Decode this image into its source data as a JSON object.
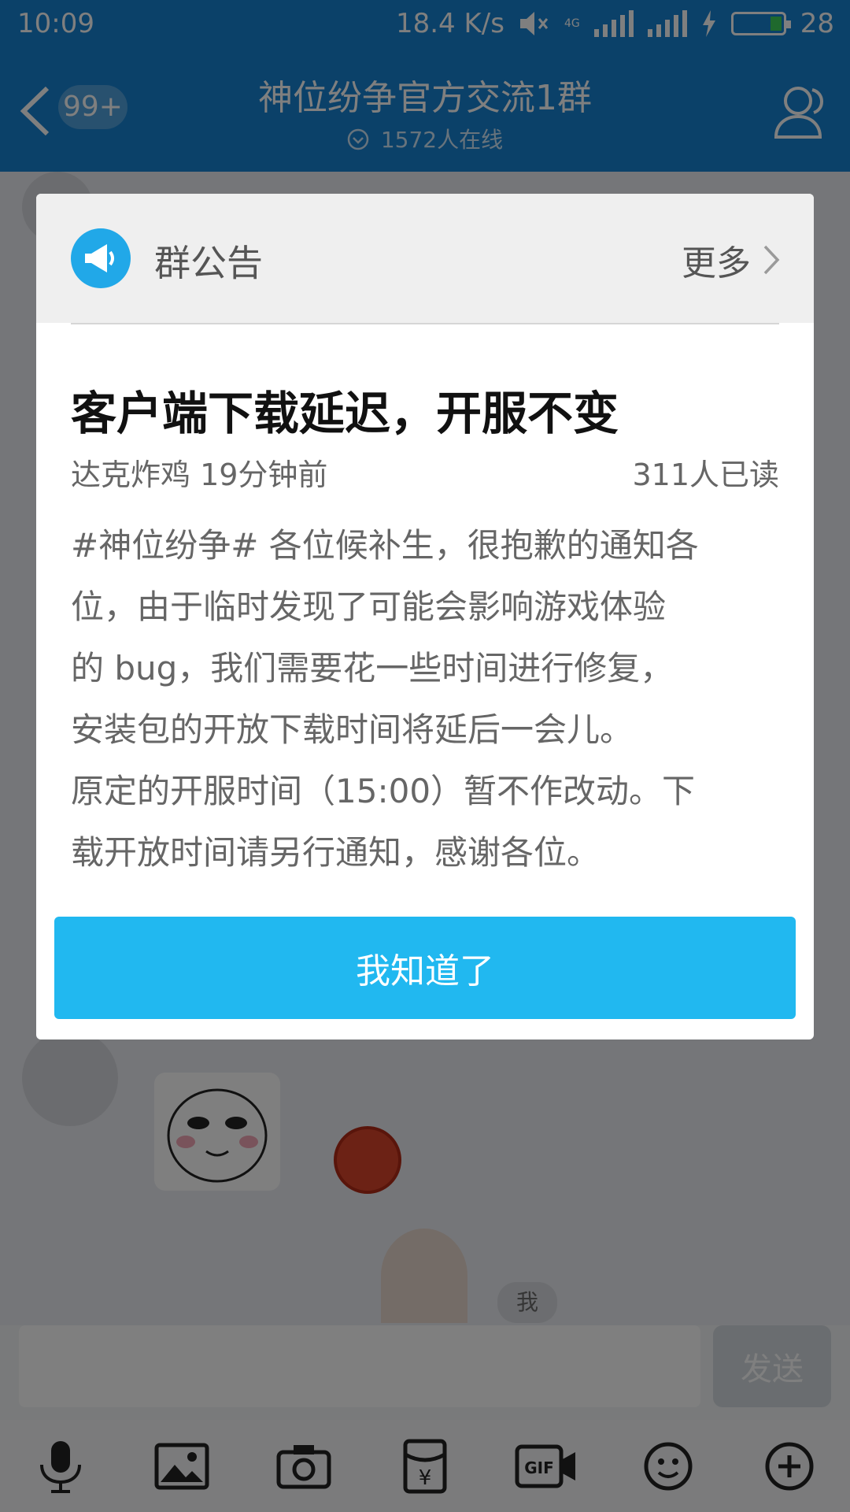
{
  "status_bar": {
    "time": "10:09",
    "speed": "18.4 K/s",
    "network": "4G",
    "battery_level": "28"
  },
  "header": {
    "unread_badge": "99+",
    "group_name": "神位纷争官方交流1群",
    "online_count": "1572人在线"
  },
  "dialog": {
    "header_title": "群公告",
    "more_label": "更多",
    "notice_title": "客户端下载延迟，开服不变",
    "author_time": "达克炸鸡 19分钟前",
    "read_count": "311人已读",
    "body": "#神位纷争# 各位候补生，很抱歉的通知各\n位，由于临时发现了可能会影响游戏体验\n的 bug，我们需要花一些时间进行修复，\n安装包的开放下载时间将延后一会儿。\n原定的开服时间（15:00）暂不作改动。下\n载开放时间请另行通知，感谢各位。",
    "ok_button": "我知道了"
  },
  "chat": {
    "me_label": "我"
  },
  "input": {
    "send_label": "发送"
  },
  "toolbar": {
    "icons": [
      "microphone-icon",
      "image-icon",
      "camera-icon",
      "red-packet-icon",
      "gif-icon",
      "emoji-icon",
      "plus-icon"
    ],
    "gif_label": "GIF",
    "yen_label": "¥"
  },
  "colors": {
    "header_blue": "#1683d3",
    "accent_blue": "#21b8f0"
  }
}
